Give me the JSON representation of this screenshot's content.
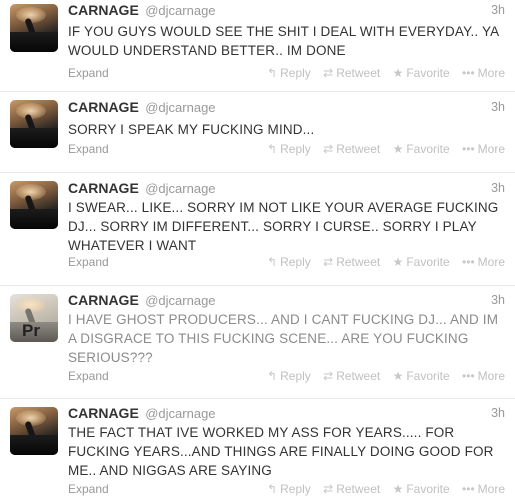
{
  "tweets": [
    {
      "name": "CARNAGE",
      "handle": "@djcarnage",
      "time": "3h",
      "text": "IF YOU GUYS WOULD SEE THE SHIT I DEAL WITH EVERYDAY.. YA WOULD UNDERSTAND BETTER.. IM DONE",
      "expand": "Expand",
      "reply": "Reply",
      "retweet": "Retweet",
      "favorite": "Favorite",
      "more": "More"
    },
    {
      "name": "CARNAGE",
      "handle": "@djcarnage",
      "time": "3h",
      "text": "SORRY I SPEAK MY FUCKING MIND...",
      "expand": "Expand",
      "reply": "Reply",
      "retweet": "Retweet",
      "favorite": "Favorite",
      "more": "More"
    },
    {
      "name": "CARNAGE",
      "handle": "@djcarnage",
      "time": "3h",
      "text": "I SWEAR... LIKE... SORRY IM NOT LIKE YOUR AVERAGE FUCKING DJ... SORRY IM DIFFERENT... SORRY I CURSE.. SORRY I PLAY WHATEVER I WANT",
      "expand": "Expand",
      "reply": "Reply",
      "retweet": "Retweet",
      "favorite": "Favorite",
      "more": "More"
    },
    {
      "name": "CARNAGE",
      "handle": "@djcarnage",
      "time": "3h",
      "text": "I HAVE GHOST PRODUCERS... AND I CANT FUCKING DJ... AND IM A DISGRACE TO THIS FUCKING SCENE... ARE YOU FUCKING SERIOUS???",
      "expand": "Expand",
      "reply": "Reply",
      "retweet": "Retweet",
      "favorite": "Favorite",
      "more": "More",
      "avatar_text": "Pr"
    },
    {
      "name": "CARNAGE",
      "handle": "@djcarnage",
      "time": "3h",
      "text": "THE FACT THAT IVE WORKED MY ASS FOR YEARS..... FOR FUCKING YEARS...AND THINGS ARE FINALLY DOING GOOD FOR ME.. AND NIGGAS ARE SAYING",
      "expand": "Expand",
      "reply": "Reply",
      "retweet": "Retweet",
      "favorite": "Favorite",
      "more": "More"
    }
  ],
  "icons": {
    "reply": "reply-arrow-icon",
    "retweet": "retweet-icon",
    "favorite": "star-icon",
    "more": "ellipsis-icon"
  },
  "colors": {
    "text": "#333333",
    "muted": "#999999",
    "action": "#c0c0c0",
    "divider": "#e8e8e8"
  }
}
